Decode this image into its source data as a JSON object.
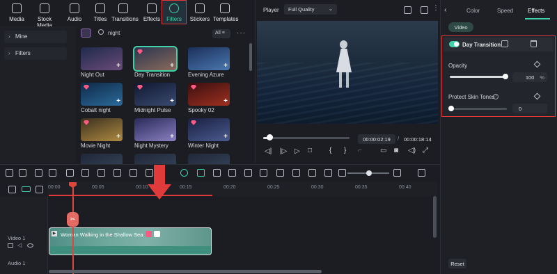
{
  "toolbar": {
    "items": [
      {
        "label": "Media",
        "icon": "media-icon"
      },
      {
        "label": "Stock Media",
        "icon": "stock-media-icon"
      },
      {
        "label": "Audio",
        "icon": "audio-icon"
      },
      {
        "label": "Titles",
        "icon": "titles-icon"
      },
      {
        "label": "Transitions",
        "icon": "transitions-icon"
      },
      {
        "label": "Effects",
        "icon": "effects-icon"
      },
      {
        "label": "Filters",
        "icon": "filters-icon",
        "selected": true
      },
      {
        "label": "Stickers",
        "icon": "stickers-icon"
      },
      {
        "label": "Templates",
        "icon": "templates-icon"
      }
    ]
  },
  "sidebar": {
    "items": [
      {
        "label": "Mine"
      },
      {
        "label": "Filters"
      }
    ]
  },
  "browser": {
    "search_value": "night",
    "filter_label": "All"
  },
  "filters": [
    {
      "label": "Night Out",
      "premium": false,
      "colors": [
        "#1f2b4a",
        "#6a4a7a"
      ]
    },
    {
      "label": "Day Transition",
      "premium": true,
      "selected": true,
      "colors": [
        "#2a3550",
        "#8a6a5a"
      ]
    },
    {
      "label": "Evening Azure",
      "premium": false,
      "colors": [
        "#1b2f5a",
        "#4a78b0"
      ]
    },
    {
      "label": "Cobalt night",
      "premium": true,
      "colors": [
        "#0f2a48",
        "#2b6a9a"
      ]
    },
    {
      "label": "Midnight Pulse",
      "premium": true,
      "colors": [
        "#101830",
        "#3a4a70"
      ]
    },
    {
      "label": "Spooky 02",
      "premium": true,
      "colors": [
        "#3a0f10",
        "#a03020"
      ]
    },
    {
      "label": "Movie Night",
      "premium": true,
      "colors": [
        "#3a3020",
        "#b08a40"
      ]
    },
    {
      "label": "Night Mystery",
      "premium": false,
      "colors": [
        "#2a2a5a",
        "#8a80c0"
      ]
    },
    {
      "label": "Winter Night",
      "premium": true,
      "colors": [
        "#1a2040",
        "#4a5a90"
      ]
    },
    {
      "label": "",
      "premium": false,
      "colors": [
        "#202838",
        "#3a4860"
      ]
    },
    {
      "label": "",
      "premium": false,
      "colors": [
        "#202838",
        "#3a4860"
      ]
    },
    {
      "label": "",
      "premium": false,
      "colors": [
        "#202838",
        "#3a4860"
      ]
    }
  ],
  "player": {
    "label": "Player",
    "quality": "Full Quality",
    "current_time": "00:00:02:19",
    "total_time": "00:00:18:14",
    "progress": 0.07
  },
  "properties": {
    "tabs": [
      {
        "label": "Color"
      },
      {
        "label": "Speed"
      },
      {
        "label": "Effects",
        "active": true
      }
    ],
    "subtab": "Video",
    "effect_name": "Day Transition",
    "opacity_label": "Opacity",
    "opacity_value": "100",
    "opacity_unit": "%",
    "opacity_level": 1.0,
    "skin_label": "Protect Skin Tones",
    "skin_value": "0",
    "skin_level": 0.0,
    "reset_label": "Reset"
  },
  "timeline": {
    "ticks": [
      "00:00",
      "00:05",
      "00:10",
      "00:15",
      "00:20",
      "00:25",
      "00:30",
      "00:35",
      "00:40"
    ],
    "tracks": [
      {
        "label": "Video 1"
      },
      {
        "label": "Audio 1"
      }
    ],
    "clip_label": "Woman Walking in the Shallow Sea"
  },
  "colors": {
    "accent": "#3ed3a8",
    "highlight": "#e03a3a",
    "clip": "#3f8f7e"
  }
}
